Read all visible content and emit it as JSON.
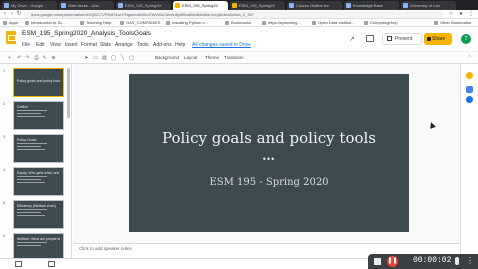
{
  "browser": {
    "tabs": [
      {
        "label": "My Drive - Google",
        "active": false
      },
      {
        "label": "slide decks - Utsc",
        "active": false
      },
      {
        "label": "ESM_195_SpringXX",
        "active": false
      },
      {
        "label": "ESM_195_Spring20",
        "active": true
      },
      {
        "label": "ESM_195_Spring20",
        "active": false
      },
      {
        "label": "Course Outline lec",
        "active": false
      },
      {
        "label": "Knowledge Base",
        "active": false
      },
      {
        "label": "University of Lan",
        "active": false
      }
    ],
    "url": "docs.google.com/presentation/d/1QBCTVP8nf74wu7Ngumo6hl0mCWvWsCdmfedlyd9bs6I/edit#slide=id.g8c3ea3c0da_0_367",
    "bookmarks": [
      "Apps",
      "Introduction to Sc...",
      "Teaching Help",
      "GAS_COMPANIES",
      "Installing Python o...",
      "Bookmarks",
      "https://eplanning...",
      "Open Data Instituti...",
      "ComputingHelp",
      "Other Bookmarks"
    ]
  },
  "doc": {
    "title": "ESM_195_Spring2020_Analysis_ToolsGoals",
    "menu": [
      "File",
      "Edit",
      "View",
      "Insert",
      "Format",
      "Slide",
      "Arrange",
      "Tools",
      "Add-ons",
      "Help"
    ],
    "saved_status": "All changes saved in Drive",
    "present_label": "Present",
    "share_label": "Share",
    "avatar_initial": "T"
  },
  "toolbar": {
    "background_label": "Background",
    "layout_label": "Layout",
    "theme_label": "Theme",
    "transition_label": "Transition"
  },
  "filmstrip": {
    "slides": [
      {
        "num": "1",
        "title": "Policy goals and policy tools",
        "selected": true
      },
      {
        "num": "2",
        "title": "Outline",
        "selected": false
      },
      {
        "num": "3",
        "title": "Policy Goals",
        "selected": false
      },
      {
        "num": "4",
        "title": "Equity, Who gets what, and how?",
        "selected": false
      },
      {
        "num": "5",
        "title": "Efficiency (Welfare econ)",
        "selected": false
      },
      {
        "num": "6",
        "title": "Welfare: What are people better off",
        "selected": false
      }
    ]
  },
  "slide": {
    "title": "Policy goals and policy tools",
    "dots": "•••",
    "subtitle": "ESM 195 - Spring 2020"
  },
  "notes": {
    "placeholder": "Click to add speaker notes"
  },
  "recorder": {
    "time": "00:00:02"
  },
  "colors": {
    "slide_bg": "#3d4a4f",
    "accent": "#f4b400",
    "link": "#1a73e8",
    "record": "#ea4335"
  }
}
